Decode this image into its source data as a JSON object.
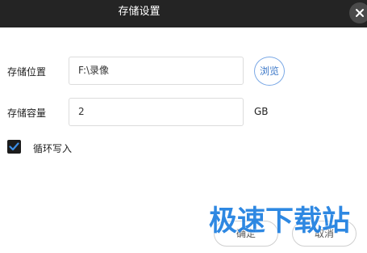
{
  "dialog": {
    "title": "存储设置",
    "close_icon": "close-icon"
  },
  "storage_location": {
    "label": "存储位置",
    "value": "F:\\录像",
    "browse_label": "浏览"
  },
  "storage_capacity": {
    "label": "存储容量",
    "value": "2",
    "unit": "GB"
  },
  "loop_write": {
    "label": "循环写入",
    "checked": true
  },
  "footer": {
    "confirm_label": "确定",
    "cancel_label": "取消"
  },
  "watermark": {
    "text": "极速下载站"
  },
  "colors": {
    "titlebar": "#242424",
    "accent": "#3c78c8",
    "watermark": "#1f7fe0"
  }
}
